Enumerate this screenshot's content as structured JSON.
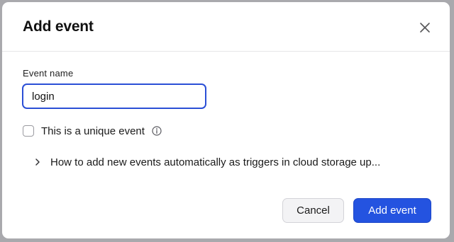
{
  "dialog": {
    "title": "Add event",
    "close_icon": "close-icon"
  },
  "form": {
    "event_name_label": "Event name",
    "event_name_value": "login",
    "unique_checkbox_label": "This is a unique event",
    "unique_checked": false,
    "info_icon": "info-icon"
  },
  "disclosure": {
    "text": "How to add new events automatically as triggers in cloud storage up...",
    "icon": "chevron-right-icon"
  },
  "footer": {
    "cancel_label": "Cancel",
    "submit_label": "Add event"
  },
  "colors": {
    "accent": "#2453e0",
    "input_focus_border": "#2b4fd6",
    "backdrop": "#a9a9ad"
  }
}
